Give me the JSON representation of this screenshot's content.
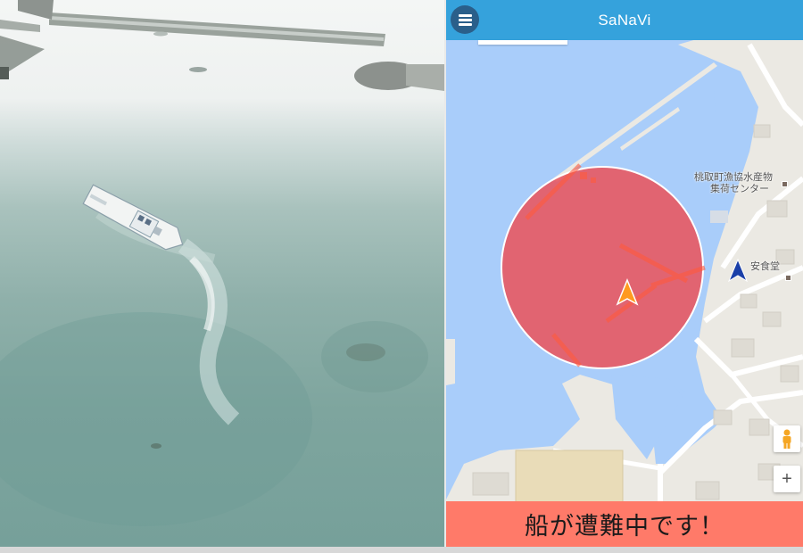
{
  "app": {
    "title": "SaNaVi",
    "menu_icon": "hamburger-menu-icon"
  },
  "map": {
    "poi_fish_center": [
      "桃取町漁協水産物",
      "集荷センター"
    ],
    "poi_restaurant": "安食堂",
    "alert_zone_color": "#e8555d",
    "vessel_marker_color": "#ff9a1f",
    "user_marker_color": "#1a3fa8",
    "controls": {
      "street_view_icon": "pegman-icon",
      "zoom_in_label": "+"
    }
  },
  "banner": {
    "message": "船が遭難中です！",
    "color": "#ff7a69"
  },
  "photo": {
    "subject": "aerial-boat-photo"
  }
}
